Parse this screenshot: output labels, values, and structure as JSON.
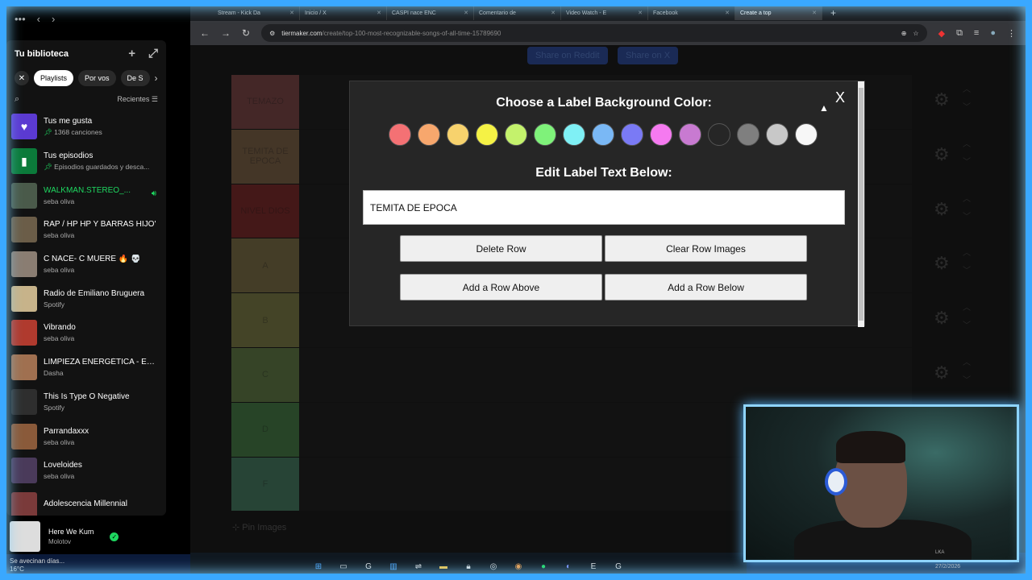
{
  "spotify": {
    "library_title": "Tu biblioteca",
    "chips": [
      "Playlists",
      "Por vos",
      "De S"
    ],
    "sort_label": "Recientes",
    "items": [
      {
        "title": "Tus me gusta",
        "sub": "1368 canciones",
        "pinned": true,
        "color": "#5b3ad1",
        "glyph": "♥"
      },
      {
        "title": "Tus episodios",
        "sub": "Episodios guardados y desca...",
        "pinned": true,
        "color": "#0b7a3a",
        "glyph": "▮"
      },
      {
        "title": "WALKMAN.STEREO_...",
        "sub": "seba oliva",
        "playing": true,
        "color": "#4a5a4a",
        "glyph": ""
      },
      {
        "title": "RAP / HP HP Y BARRAS HIJO'",
        "sub": "seba oliva",
        "color": "#6b5d48",
        "glyph": ""
      },
      {
        "title": "C NACE- C MUERE 🔥 💀",
        "sub": "seba oliva",
        "color": "#8a7d72",
        "glyph": ""
      },
      {
        "title": "Radio de Emiliano Bruguera",
        "sub": "Spotify",
        "color": "#c7b38a",
        "glyph": ""
      },
      {
        "title": "Vibrando",
        "sub": "seba oliva",
        "color": "#b03a2e",
        "glyph": ""
      },
      {
        "title": "LIMPIEZA ENERGÉTICA - EL...",
        "sub": "Dasha",
        "color": "#a07050",
        "glyph": ""
      },
      {
        "title": "This Is Type O Negative",
        "sub": "Spotify",
        "color": "#2e2e2e",
        "glyph": ""
      },
      {
        "title": "Parrandaxxx",
        "sub": "seba oliva",
        "color": "#8a5a3a",
        "glyph": ""
      },
      {
        "title": "Loveloides",
        "sub": "seba oliva",
        "color": "#4a3a5a",
        "glyph": ""
      },
      {
        "title": "Adolescencia Millennial",
        "sub": "",
        "color": "#7a3a3a",
        "glyph": ""
      }
    ],
    "now_playing": {
      "title": "Here We Kum",
      "artist": "Molotov"
    },
    "weather": {
      "line1": "Se avecinan días...",
      "line2": "16°C"
    }
  },
  "browser": {
    "tabs": [
      "Stream - Kick Da",
      "Inicio / X",
      "CASPI nace ENC",
      "Comentario de",
      "Video Watch - E",
      "Facebook",
      "Create a top"
    ],
    "url_host": "tiermaker.com",
    "url_path": "/create/top-100-most-recognizable-songs-of-all-time-15789690"
  },
  "page": {
    "top_buttons": [
      "Share on Reddit",
      "Share on X"
    ],
    "tiers": [
      {
        "label": "TEMAZO",
        "color": "#ff7f7f"
      },
      {
        "label": "TEMITA DE EPOCA",
        "color": "#ffbf7f"
      },
      {
        "label": "NIVEL DIOS",
        "color": "#ff3b3b"
      },
      {
        "label": "A",
        "color": "#ffdf7f"
      },
      {
        "label": "B",
        "color": "#ffff7f"
      },
      {
        "label": "C",
        "color": "#bfff7f"
      },
      {
        "label": "D",
        "color": "#7fff7f"
      },
      {
        "label": "F",
        "color": "#7fffbf"
      }
    ],
    "left_cut_letters": [
      "R",
      "A",
      "A"
    ],
    "pin_images": "Pin Images"
  },
  "modal": {
    "title": "Choose a Label Background Color:",
    "colors": [
      "#f47174",
      "#f7a76d",
      "#f7d26d",
      "#f5f245",
      "#c4f26c",
      "#7ff27a",
      "#7ff0f5",
      "#7ab8f5",
      "#7a7af5",
      "#f57af0",
      "#c87ad1",
      "#262626",
      "#7f7f7f",
      "#c8c8c8",
      "#f7f7f7"
    ],
    "edit_label": "Edit Label Text Below:",
    "input_value": "TEMITA DE EPOCA",
    "buttons": {
      "delete_row": "Delete Row",
      "clear_images": "Clear Row Images",
      "add_above": "Add a Row Above",
      "add_below": "Add a Row Below"
    },
    "close": "X"
  },
  "webcam": {
    "overlay": "LKA"
  },
  "tray": {
    "date": "27/2/2026"
  }
}
